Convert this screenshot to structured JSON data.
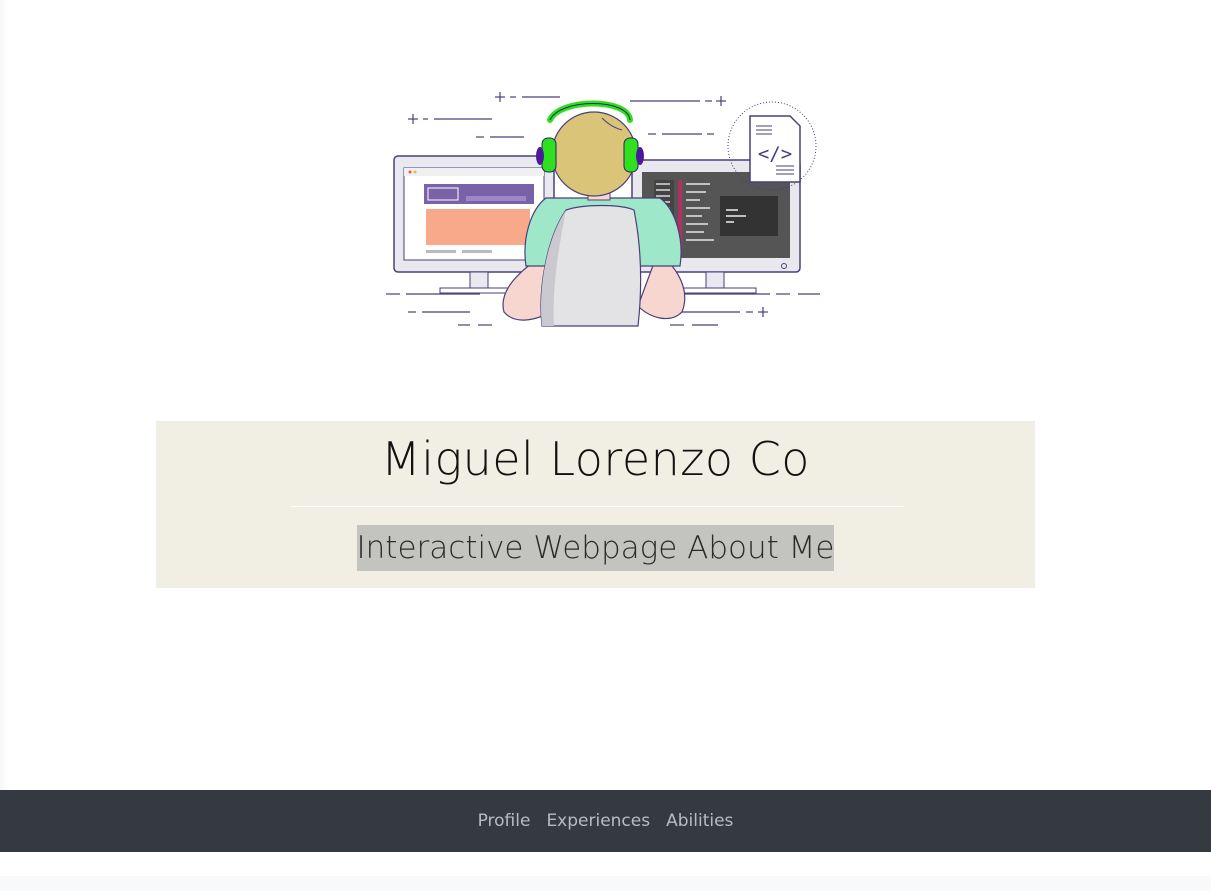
{
  "hero": {
    "illustration": "developer-at-dual-monitors",
    "code_symbol": "</>"
  },
  "title_card": {
    "name": "Miguel Lorenzo Co",
    "subtitle": "Interactive Webpage About Me"
  },
  "navbar": {
    "links": [
      "Profile",
      "Experiences",
      "Abilities"
    ]
  },
  "colors": {
    "card_background": "#f1efe3",
    "subtitle_highlight": "#c3c3bf",
    "navbar_background": "#343a40",
    "nav_link": "#b9bcbf",
    "accent_purple": "#7a62a8",
    "headphones_green": "#2fe01e"
  }
}
